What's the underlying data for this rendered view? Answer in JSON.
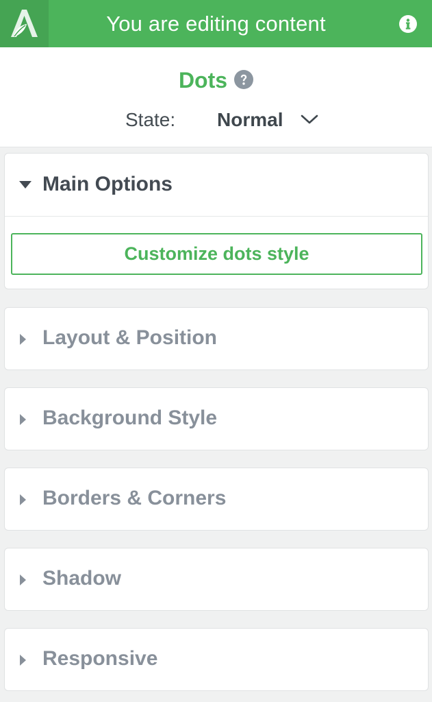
{
  "topbar": {
    "title": "You are editing content",
    "logo_icon": "oxygen-builder-logo-icon",
    "info_icon": "info-icon"
  },
  "element": {
    "title": "Dots",
    "help_icon": "question-circle-icon",
    "state_label": "State:",
    "state_value": "Normal"
  },
  "panels": [
    {
      "label": "Main Options",
      "expanded": true
    },
    {
      "label": "Layout & Position",
      "expanded": false
    },
    {
      "label": "Background Style",
      "expanded": false
    },
    {
      "label": "Borders & Corners",
      "expanded": false
    },
    {
      "label": "Shadow",
      "expanded": false
    },
    {
      "label": "Responsive",
      "expanded": false
    }
  ],
  "main_options": {
    "customize_label": "Customize dots style"
  },
  "colors": {
    "accent": "#4cb45b",
    "logo_bg": "#45a453",
    "heading_text": "#434a52",
    "muted_text": "#88909a",
    "page_bg": "#f0f1f1"
  }
}
